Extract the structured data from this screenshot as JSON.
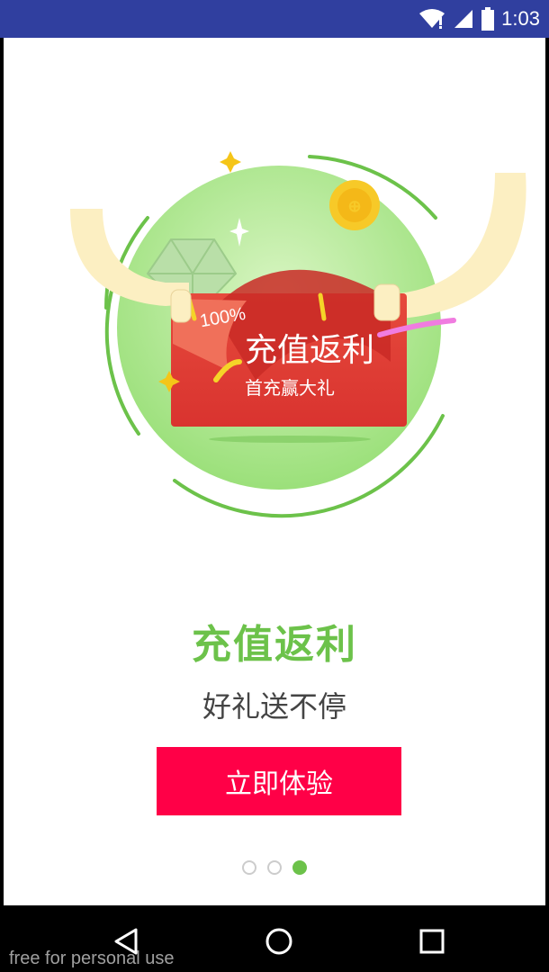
{
  "status_bar": {
    "time": "1:03",
    "icons": [
      "wifi-icon",
      "cell-signal-icon",
      "battery-icon"
    ],
    "color": "#303F9F"
  },
  "illustration": {
    "badge": "100%",
    "card_title": "充值返利",
    "card_subtitle": "首充赢大礼"
  },
  "headline": "充值返利",
  "subline": "好礼送不停",
  "cta_label": "立即体验",
  "pager": {
    "count": 3,
    "active": 3
  },
  "colors": {
    "accent": "#6CC24A",
    "cta": "#FF0047",
    "card_red": "#E23A34"
  },
  "nav_bar": {
    "buttons": [
      "back-icon",
      "home-icon",
      "recents-icon"
    ]
  },
  "watermark": "free for personal use"
}
